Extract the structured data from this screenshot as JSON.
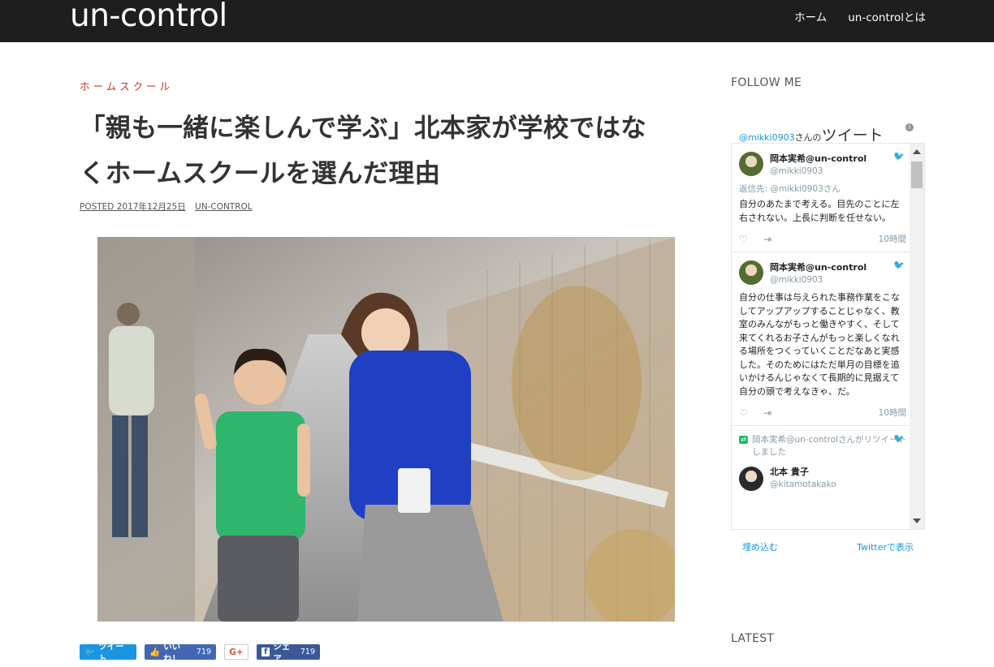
{
  "header": {
    "logo": "un-control",
    "nav": [
      "ホーム",
      "un-controlとは"
    ]
  },
  "article": {
    "category": "ホームスクール",
    "title_line1": "「親も一緒に楽しんで学ぶ」北本家が学校ではな",
    "title_line2": "くホームスクールを選んだ理由",
    "posted": "POSTED 2017年12月25日",
    "author": "UN-CONTROL"
  },
  "share": {
    "tweet": "ツイート",
    "like": "いいね！",
    "like_count": "719",
    "google": "G+",
    "fb_share": "シェア",
    "fb_share_count": "719"
  },
  "sidebar": {
    "follow_title": "FOLLOW ME",
    "latest_title": "LATEST",
    "twitter": {
      "header_handle": "@mikki0903",
      "header_suffix": "さんの",
      "header_tweet": "ツイート",
      "info_icon": "info-icon",
      "tweets": [
        {
          "name": "岡本実希@un-control",
          "handle": "@mikki0903",
          "reply_to": "返信先: @mikki0903さん",
          "text": "自分のあたまで考える。目先のことに左右されない。上長に判断を任せない。",
          "time": "10時間"
        },
        {
          "name": "岡本実希@un-control",
          "handle": "@mikki0903",
          "text": "自分の仕事は与えられた事務作業をこなしてアップアップすることじゃなく、教室のみんながもっと働きやすく、そして来てくれるお子さんがもっと楽しくなれる場所をつくっていくことだなあと実感した。そのためにはただ単月の目標を追いかけるんじゃなくて長期的に見据えて自分の頭で考えなきゃ、だ。",
          "time": "10時間"
        }
      ],
      "retweet_label": "岡本実希@un-controlさんがリツイートしました",
      "retweet_name": "北本 貴子",
      "retweet_handle": "@kitamotakako",
      "embed": "埋め込む",
      "view": "Twitterで表示"
    }
  },
  "colors": {
    "header_bg": "#1e1e1e",
    "category": "#c0392b",
    "twitter_blue": "#1b95e0",
    "facebook": "#4267b2"
  }
}
